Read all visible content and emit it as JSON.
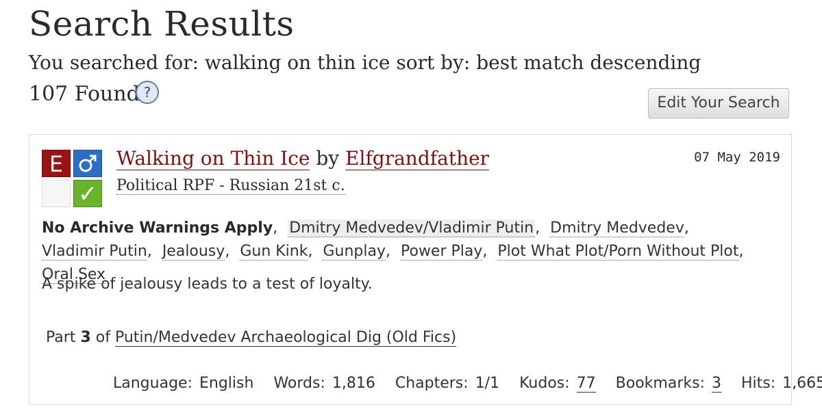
{
  "header": {
    "title": "Search Results",
    "summary": "You searched for: walking on thin ice sort by: best match descending",
    "found": "107 Found",
    "help_symbol": "?",
    "edit_button": "Edit Your Search"
  },
  "work": {
    "required_tags": {
      "rating_letter": "E",
      "category_icon": "male-symbol-icon",
      "warning_icon": "blank-warning-icon",
      "complete_icon": "checkmark-icon",
      "complete_symbol": "✓",
      "colors": {
        "rating": "#9a1212",
        "category": "#2a6fc5",
        "complete": "#69b529"
      }
    },
    "title": "Walking on Thin Ice",
    "by": "by",
    "author": "Elfgrandfather",
    "fandom": "Political RPF - Russian 21st c.",
    "date": "07 May 2019",
    "tags": [
      {
        "text": "No Archive Warnings Apply",
        "kind": "warning"
      },
      {
        "text": "Dmitry Medvedev/Vladimir Putin",
        "kind": "relationship"
      },
      {
        "text": "Dmitry Medvedev",
        "kind": "character"
      },
      {
        "text": "Vladimir Putin",
        "kind": "character"
      },
      {
        "text": "Jealousy",
        "kind": "freeform"
      },
      {
        "text": "Gun Kink",
        "kind": "freeform"
      },
      {
        "text": "Gunplay",
        "kind": "freeform"
      },
      {
        "text": "Power Play",
        "kind": "freeform"
      },
      {
        "text": "Plot What Plot/Porn Without Plot",
        "kind": "freeform"
      },
      {
        "text": "Oral Sex",
        "kind": "freeform"
      }
    ],
    "tag_separator": ",",
    "summary": "A spike of jealousy leads to a test of loyalty.",
    "series": {
      "part_label": "Part",
      "part_number": "3",
      "of_label": "of",
      "name": "Putin/Medvedev Archaeological Dig (Old Fics)"
    },
    "stats": {
      "language_label": "Language:",
      "language": "English",
      "words_label": "Words:",
      "words": "1,816",
      "chapters_label": "Chapters:",
      "chapters": "1/1",
      "kudos_label": "Kudos:",
      "kudos": "77",
      "bookmarks_label": "Bookmarks:",
      "bookmarks": "3",
      "hits_label": "Hits:",
      "hits": "1,665"
    }
  }
}
